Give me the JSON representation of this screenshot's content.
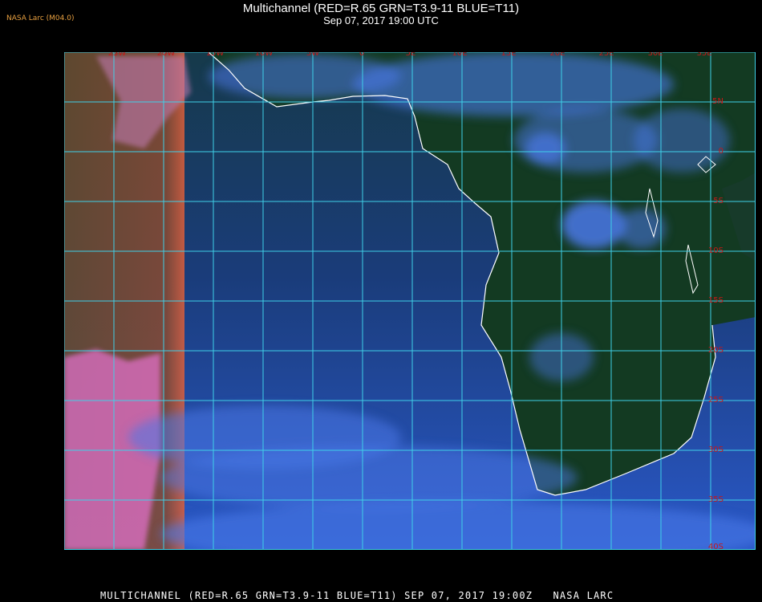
{
  "header": {
    "agency": "NASA Larc (M04.0)",
    "title": "Multichannel (RED=R.65 GRN=T3.9-11 BLUE=T11)",
    "datetime": "Sep 07, 2017 19:00 UTC"
  },
  "map": {
    "lon_labels": [
      "25W",
      "20W",
      "15W",
      "10W",
      "5W",
      "0",
      "5E",
      "10E",
      "15E",
      "20E",
      "25E",
      "30E",
      "35E"
    ],
    "lat_labels": [
      "5N",
      "0",
      "5S",
      "10S",
      "15S",
      "20S",
      "25S",
      "30S",
      "35S",
      "40S"
    ],
    "colors": {
      "grid": "#3fd0e8",
      "label": "#c81818",
      "coast": "#ffffff",
      "land": "#123a1a",
      "ocean": "#1a3c7a",
      "cloud": "#4a78e8",
      "terminator": "#e0603a"
    }
  },
  "footer": {
    "caption": "MULTICHANNEL (RED=R.65 GRN=T3.9-11 BLUE=T11) SEP 07, 2017 19:00Z   NASA LARC"
  }
}
